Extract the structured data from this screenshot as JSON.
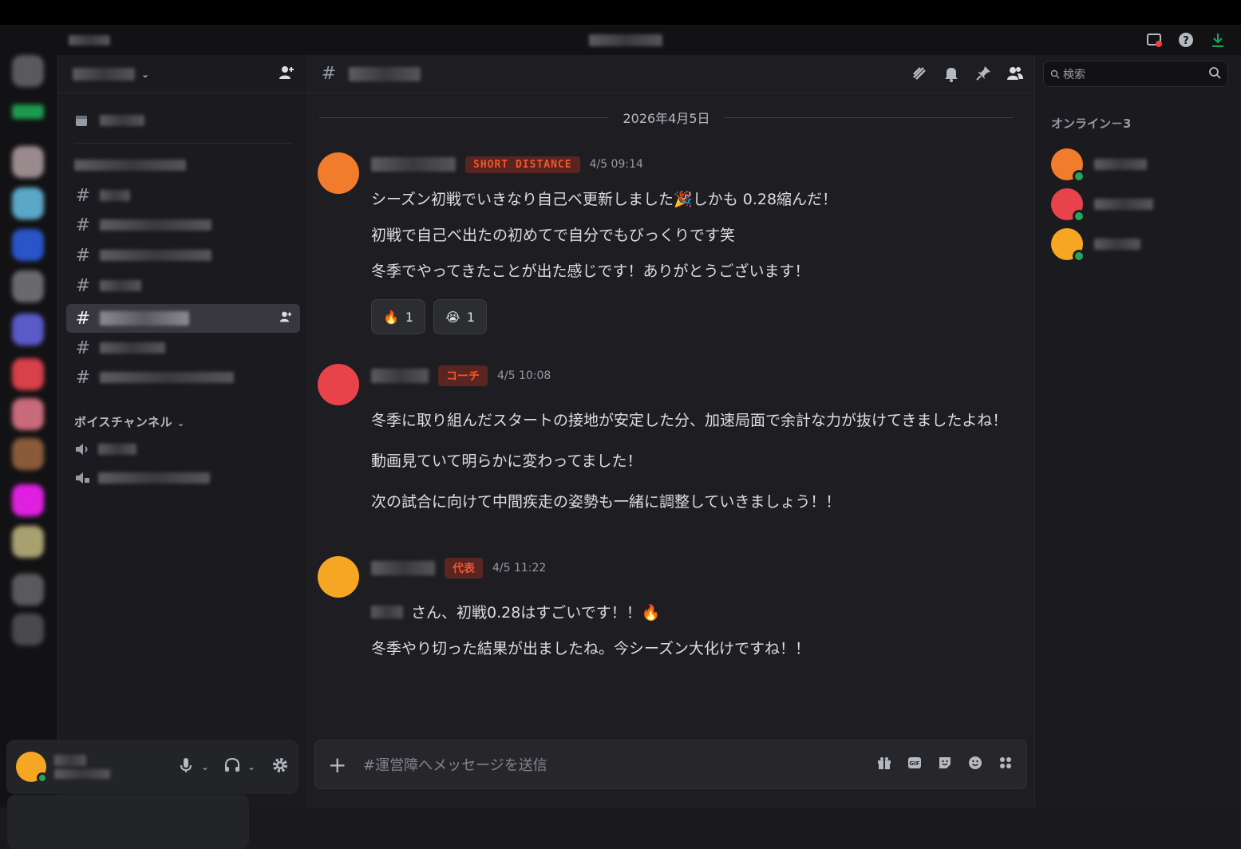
{
  "title_bar": {
    "icons": [
      "inbox-icon",
      "help-icon",
      "download-icon"
    ],
    "colors": {
      "download": "#23a55a",
      "inbox_badge": "#f23f43"
    }
  },
  "channel_panel": {
    "header": {
      "icon": "add-member-icon"
    },
    "voice_category_label": "ボイスチャンネル",
    "hash": "#"
  },
  "main": {
    "header_hash": "#",
    "header_icons": [
      "threads-icon",
      "bell-icon",
      "pin-icon",
      "members-icon"
    ],
    "date_divider": "2026年4月5日",
    "messages": [
      {
        "role": "SHORT DISTANCE",
        "role_color": "#f0562d",
        "time": "4/5 09:14",
        "avatar_color": "#f07c2c",
        "lines": [
          "シーズン初戦でいきなり自己ベ更新しました🎉しかも 0.28縮んだ！",
          "初戦で自己ベ出たの初めてで自分でもびっくりです笑",
          "冬季でやってきたことが出た感じです！ありがとうございます！"
        ],
        "reactions": [
          {
            "emoji": "🔥",
            "count": "1"
          },
          {
            "emoji": "😭",
            "count": "1"
          }
        ]
      },
      {
        "role": "コーチ",
        "role_color": "#f0562d",
        "time": "4/5 10:08",
        "avatar_color": "#e8424b",
        "lines": [
          "冬季に取り組んだスタートの接地が安定した分、加速局面で余計な力が抜けてきましたよね！",
          "動画見ていて明らかに変わってました！",
          "次の試合に向けて中間疾走の姿勢も一緒に調整していきましょう！！"
        ]
      },
      {
        "role": "代表",
        "role_color": "#f0562d",
        "time": "4/5 11:22",
        "avatar_color": "#f5a623",
        "lines": [
          "さん、初戦0.28はすごいです！！🔥",
          "冬季やり切った結果が出ましたね。今シーズン大化けですね！！"
        ]
      }
    ],
    "composer": {
      "placeholder": "#運営障へメッセージを送信",
      "icons": [
        "gift-icon",
        "gif-icon",
        "sticker-icon",
        "emoji-icon",
        "apps-icon"
      ]
    }
  },
  "members": {
    "search_placeholder": "検索",
    "online_header": "オンライン－3",
    "list": [
      {
        "avatar_color": "#f07c2c",
        "status": "online"
      },
      {
        "avatar_color": "#e8424b",
        "status": "online"
      },
      {
        "avatar_color": "#f5a623",
        "status": "online"
      }
    ]
  },
  "user_bar": {
    "avatar_color": "#f5a623",
    "icons": [
      "microphone-icon",
      "headphones-icon",
      "settings-icon"
    ]
  }
}
